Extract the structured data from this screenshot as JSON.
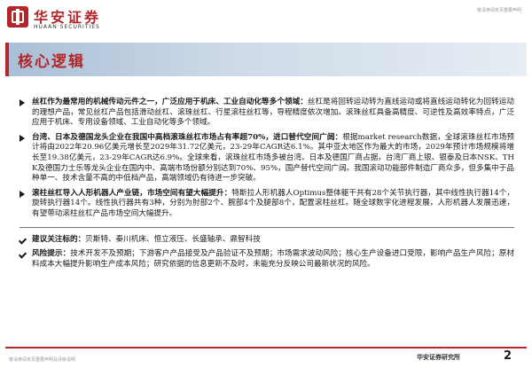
{
  "header": {
    "logo_cn": "华安证券",
    "logo_en": "HUAAN SECURITIES",
    "corner_note": "敬请参阅末页重要声明"
  },
  "title": "核心逻辑",
  "sections": [
    {
      "paragraphs": [
        {
          "lead": "丝杠作为最常用的机械传动元件之一，广泛应用于机床、工业自动化等多个领域：",
          "body": "丝杠是将回转运动转为直线运动或将直线运动转化为回转运动的理想产品，常见丝杠产品包括滑动丝杠、滚珠丝杠、行星滚柱丝杠等，导程精度依次增加。滚珠丝杠具备高精度、可逆性及高效率特点，广泛应用于机床、专用设备领域、工业自动化等多个领域。"
        },
        {
          "lead": "台湾、日本及德国龙头企业在我国中高档滚珠丝杠市场占有率超70%，进口替代空间广阔：",
          "body": "根据market research数据，全球滚珠丝杠市场预计将由2022年20.96亿美元增长至2029年31.72亿美元，23-29年CAGR达6.1%。其中亚太地区作为最大的市场，2029年预计市场规模将增长至19.38亿美元，23-29年CAGR达6.9%。全球来看，滚珠丝杠市场多被台湾、日本及德国厂商占据，台湾厂商上银、银泰及日本NSK、THK及德国力士乐等龙头企业在国内中、高端市场份额分别达到70%、95%，国产替代空间广阔。我国滚动功能部件制造厂商众多，但多集中于品种单一、技术含量不高的中低档产品，高端领域仍有待进一步突破。"
        },
        {
          "lead": "滚柱丝杠导入人形机器人产业链，市场空间有望大幅提升：",
          "body": "特斯拉人形机器人Optimus整体躯干共有28个关节执行器，其中线性执行器14个，旋转执行器14个。线性执行器共有3种，分别为肘部2个、腕部4个及腿部8个，配置滚柱丝杠。随全球数字化进程发展，人形机器人发展迅速，有望带动滚柱丝杠产品市场空间大幅提升。"
        }
      ]
    },
    {
      "paragraphs": [
        {
          "lead": "建议关注标的：",
          "body": "贝斯特、秦川机床、恒立液压、长盛轴承、鼎智科技"
        },
        {
          "lead": "风险提示：",
          "body": "技术开发不及预期；下游客户产品接受及产品验证不及预期；市场需求波动风险；核心生产设备进口受限，影响产品生产风险；原材料成本大幅提升影响生产成本风险；研究依据的信息更新不及时，未能充分反映公司最新状况的风险。"
        }
      ]
    }
  ],
  "footer": {
    "left_note": "敬请参阅末页重要声明及评级说明",
    "org": "华安证券研究所",
    "page_number": "2"
  },
  "colors": {
    "brand_red": "#b3262a",
    "title_bar": "#a9bfd6"
  }
}
